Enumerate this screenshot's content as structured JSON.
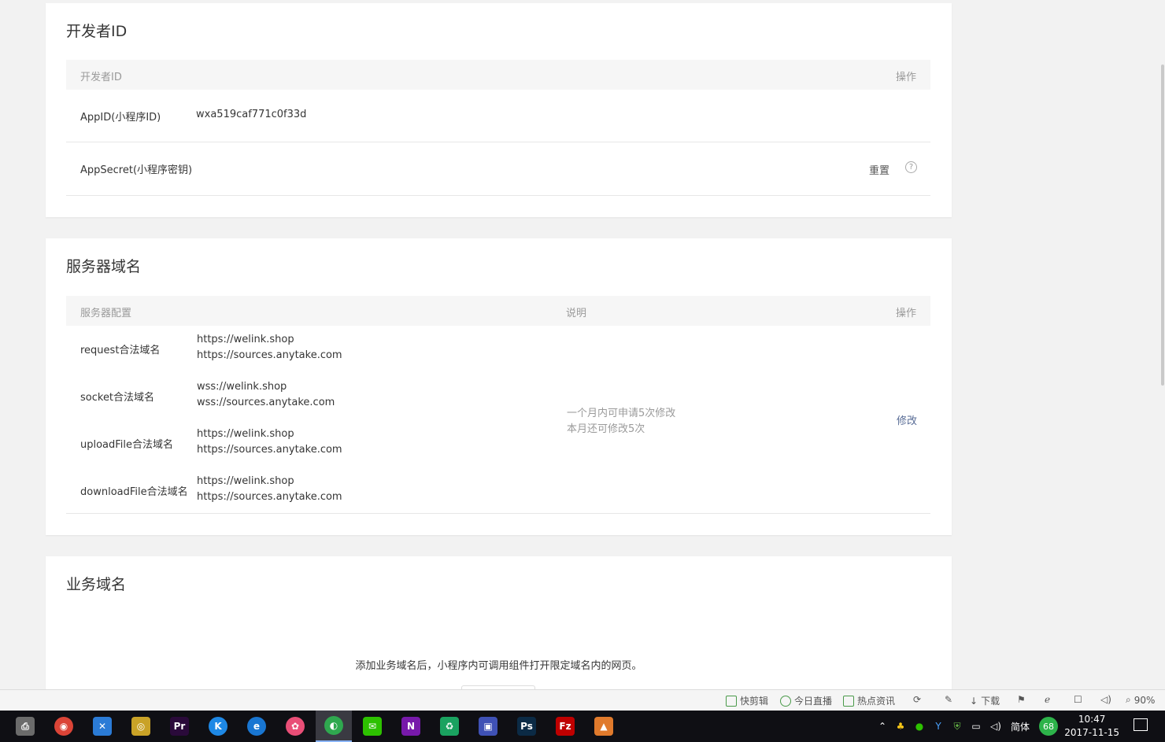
{
  "developer_card": {
    "title": "开发者ID",
    "header_col1": "开发者ID",
    "header_col_action": "操作",
    "appid_label": "AppID(小程序ID)",
    "appid_value": "wxa519caf771c0f33d",
    "appsecret_label": "AppSecret(小程序密钥)",
    "reset_label": "重置",
    "help_glyph": "?"
  },
  "server_card": {
    "title": "服务器域名",
    "header_col1": "服务器配置",
    "header_col2": "说明",
    "header_col_action": "操作",
    "rows": [
      {
        "label": "request合法域名",
        "line1": "https://welink.shop",
        "line2": "https://sources.anytake.com"
      },
      {
        "label": "socket合法域名",
        "line1": "wss://welink.shop",
        "line2": "wss://sources.anytake.com"
      },
      {
        "label": "uploadFile合法域名",
        "line1": "https://welink.shop",
        "line2": "https://sources.anytake.com"
      },
      {
        "label": "downloadFile合法域名",
        "line1": "https://welink.shop",
        "line2": "https://sources.anytake.com"
      }
    ],
    "note_line1": "一个月内可申请5次修改",
    "note_line2": "本月还可修改5次",
    "modify_label": "修改"
  },
  "business_card": {
    "title": "业务域名",
    "description": "添加业务域名后，小程序内可调用组件打开限定域名内的网页。"
  },
  "statusbar": {
    "quick_edit": "快剪辑",
    "live_today": "今日直播",
    "hot_news": "热点资讯",
    "download": "下载",
    "zoom": "90%"
  },
  "taskbar": {
    "ime": "简体",
    "badge": "68",
    "time": "10:47",
    "date": "2017-11-15",
    "apps": [
      {
        "icon": "printer-icon",
        "glyph": "⎙",
        "color": "#6b6b6b"
      },
      {
        "icon": "chrome-icon",
        "glyph": "◉",
        "color": "#db4437"
      },
      {
        "icon": "bookmark-app-icon",
        "glyph": "✕",
        "color": "#2b7bd6"
      },
      {
        "icon": "yellow-app-icon",
        "glyph": "◎",
        "color": "#c9a227"
      },
      {
        "icon": "premiere-icon",
        "glyph": "Pr",
        "color": "#2a0a3a"
      },
      {
        "icon": "k-app-icon",
        "glyph": "K",
        "color": "#1e88e5"
      },
      {
        "icon": "browser-e-icon",
        "glyph": "e",
        "color": "#1976d2"
      },
      {
        "icon": "color-wheel-icon",
        "glyph": "✿",
        "color": "#e94e77"
      },
      {
        "icon": "devtools-icon",
        "glyph": "◐",
        "color": "#2fa84f"
      },
      {
        "icon": "wechat-icon",
        "glyph": "✉",
        "color": "#2dc100"
      },
      {
        "icon": "onenote-icon",
        "glyph": "N",
        "color": "#7719aa"
      },
      {
        "icon": "recycle-app-icon",
        "glyph": "♻",
        "color": "#1aa260"
      },
      {
        "icon": "remote-desktop-icon",
        "glyph": "▣",
        "color": "#3f51b5"
      },
      {
        "icon": "photoshop-icon",
        "glyph": "Ps",
        "color": "#0b2a45"
      },
      {
        "icon": "filezilla-icon",
        "glyph": "Fz",
        "color": "#bf0000"
      },
      {
        "icon": "orange-app-icon",
        "glyph": "▲",
        "color": "#e07a2c"
      }
    ]
  }
}
